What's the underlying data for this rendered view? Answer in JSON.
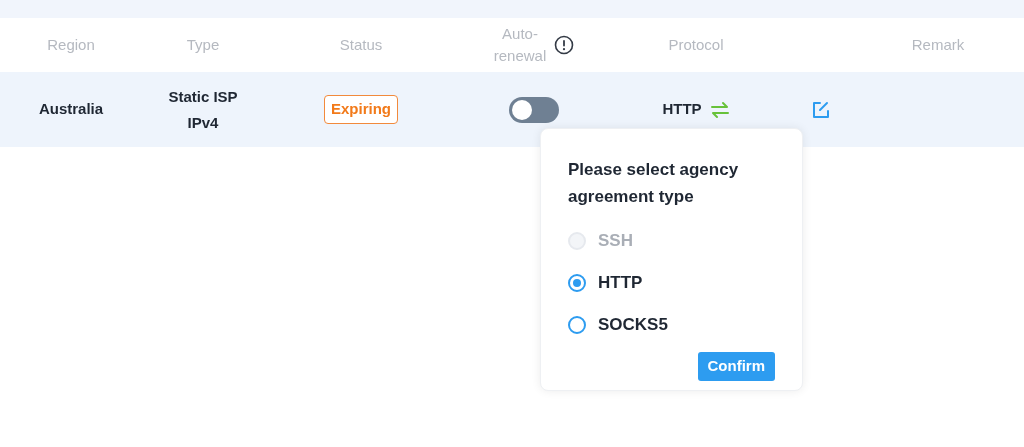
{
  "table": {
    "columns": [
      "Region",
      "Type",
      "Status",
      "Auto-\nrenewal",
      "Protocol",
      "",
      "Remark"
    ],
    "rows": [
      {
        "region": "Australia",
        "type": "Static ISP\nIPv4",
        "status": "Expiring",
        "auto_renewal": {
          "on": false
        },
        "protocol": "HTTP"
      }
    ]
  },
  "popover": {
    "title": "Please select agency agreement type",
    "options": [
      {
        "label": "SSH",
        "selected": false,
        "disabled": true
      },
      {
        "label": "HTTP",
        "selected": true,
        "disabled": false
      },
      {
        "label": "SOCKS5",
        "selected": false,
        "disabled": false
      }
    ],
    "confirm": "Confirm"
  }
}
